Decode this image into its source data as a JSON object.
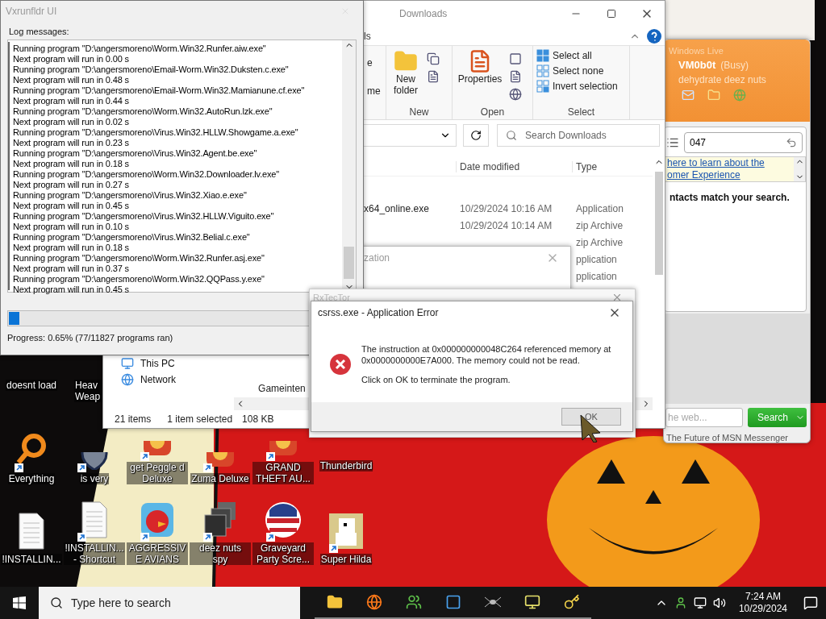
{
  "log_window": {
    "title": "Vxrunfldr UI",
    "label": "Log messages:",
    "lines": [
      "Running program \"D:\\angersmoreno\\Worm.Win32.Runfer.aiw.exe\"",
      "Next program will run in 0.00 s",
      "Running program \"D:\\angersmoreno\\Email-Worm.Win32.Duksten.c.exe\"",
      "Next program will run in 0.48 s",
      "Running program \"D:\\angersmoreno\\Email-Worm.Win32.Mamianune.cf.exe\"",
      "Next program will run in 0.44 s",
      "Running program \"D:\\angersmoreno\\Worm.Win32.AutoRun.lzk.exe\"",
      "Next program will run in 0.02 s",
      "Running program \"D:\\angersmoreno\\Virus.Win32.HLLW.Showgame.a.exe\"",
      "Next program will run in 0.23 s",
      "Running program \"D:\\angersmoreno\\Virus.Win32.Agent.be.exe\"",
      "Next program will run in 0.18 s",
      "Running program \"D:\\angersmoreno\\Worm.Win32.Downloader.lv.exe\"",
      "Next program will run in 0.27 s",
      "Running program \"D:\\angersmoreno\\Virus.Win32.Xiao.e.exe\"",
      "Next program will run in 0.45 s",
      "Running program \"D:\\angersmoreno\\Virus.Win32.HLLW.Viguito.exe\"",
      "Next program will run in 0.10 s",
      "Running program \"D:\\angersmoreno\\Virus.Win32.Belial.c.exe\"",
      "Next program will run in 0.18 s",
      "Running program \"D:\\angersmoreno\\Worm.Win32.Runfer.asj.exe\"",
      "Next program will run in 0.37 s",
      "Running program \"D:\\angersmoreno\\Worm.Win32.QQPass.y.exe\"",
      "Next program will run in 0.45 s"
    ],
    "progress": {
      "level": 0.03,
      "text": "Progress: 0.65% (77/11827 programs ran)"
    }
  },
  "explorer": {
    "title": "Downloads",
    "ribbon_tab": "ls",
    "groups": [
      {
        "kind": "partial",
        "items": [
          "e",
          "me"
        ]
      },
      {
        "kind": "big",
        "label": "New",
        "items": [
          "New folder"
        ]
      },
      {
        "kind": "big",
        "label": "Open",
        "items": [
          "Properties"
        ]
      },
      {
        "kind": "list",
        "label": "Select",
        "items": [
          "Select all",
          "Select none",
          "Invert selection"
        ]
      }
    ],
    "search_placeholder": "Search Downloads",
    "columns": [
      "Date modified",
      "Type"
    ],
    "files": [
      {
        "name": "x64_online.exe",
        "date": "10/29/2024 10:16 AM",
        "type": "Application"
      },
      {
        "date": "10/29/2024 10:14 AM",
        "type": "zip Archive"
      },
      {
        "type": "zip Archive"
      },
      {
        "type": "pplication"
      },
      {
        "type": "pplication"
      }
    ],
    "lower_item": "Gameinten",
    "nav": [
      "This PC",
      "Network"
    ],
    "status": [
      "21 items",
      "1 item selected",
      "108 KB"
    ]
  },
  "small_dialog": {
    "title": "zation"
  },
  "back_dialog": {
    "title": "RxTecTor"
  },
  "error_dialog": {
    "title": "csrss.exe - Application Error",
    "message": "The instruction at 0x000000000048C264 referenced memory at 0x0000000000E7A000. The memory could not be read.",
    "hint": "Click on OK to terminate the program.",
    "button": "OK"
  },
  "messenger": {
    "brand": "Windows Live",
    "name": "VM0b0t",
    "status": "(Busy)",
    "personal_message": "dehydrate deez nuts",
    "search_value": "047",
    "link_lines": [
      "here to learn about the",
      "omer Experience"
    ],
    "result": "ntacts match your search.",
    "web_placeholder": "he web...",
    "search_button": "Search",
    "footer": "The Future of MSN Messenger"
  },
  "desktop_icons": [
    [
      {
        "label": "doesnt load"
      },
      {
        "label": "Heav Weap",
        "cut": true
      }
    ],
    [
      {
        "label": "Everything",
        "kind": "magnifier",
        "shortcut": true
      },
      {
        "label": "is very",
        "kind": "shield",
        "shortcut": true
      },
      {
        "label": "get Peggle d Deluxe",
        "kind": "game",
        "shortcut": true
      },
      {
        "label": "Zuma Deluxe",
        "kind": "game",
        "shortcut": true
      },
      {
        "label": "GRAND THEFT AU...",
        "kind": "game",
        "shortcut": true
      },
      {
        "label": "Thunderbird"
      }
    ],
    [
      {
        "label": "!INSTALLIN...",
        "kind": "document",
        "shortcut": false
      },
      {
        "label": "!INSTALLIN... - Shortcut",
        "kind": "document",
        "shortcut": true
      },
      {
        "label": "AGGRESSIVE AVIANS",
        "kind": "bird",
        "shortcut": true
      },
      {
        "label": "deez nuts spy",
        "kind": "stack",
        "shortcut": true
      },
      {
        "label": "Graveyard Party Scre...",
        "kind": "badge",
        "shortcut": true
      },
      {
        "label": "Super Hilda",
        "kind": "pixel",
        "shortcut": true
      }
    ]
  ],
  "taskbar": {
    "search_placeholder": "Type here to search",
    "apps": [
      {
        "kind": "folder"
      },
      {
        "kind": "browser"
      },
      {
        "kind": "people"
      },
      {
        "kind": "window"
      },
      {
        "kind": "spider"
      },
      {
        "kind": "monitor"
      },
      {
        "kind": "keys"
      }
    ],
    "time": "7:24 AM",
    "date": "10/29/2024"
  }
}
